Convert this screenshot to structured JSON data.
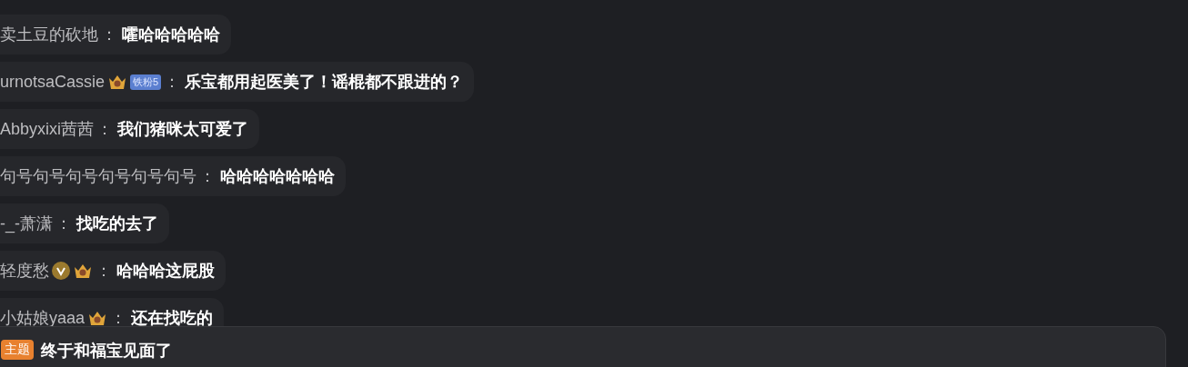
{
  "messages": [
    {
      "name": "卖土豆的砍地",
      "separator": "：",
      "text": "嚯哈哈哈哈哈"
    },
    {
      "name": "urnotsaCassie",
      "badges": [
        {
          "kind": "crown"
        },
        {
          "kind": "fan",
          "label": "铁粉5"
        }
      ],
      "separator": "：",
      "text": "乐宝都用起医美了！谣棍都不跟进的？"
    },
    {
      "name": "Abbyxixi茜茜",
      "separator": "：",
      "text": "我们猪咪太可爱了"
    },
    {
      "name": "句号句号句号句号句号句号",
      "separator": "：",
      "text": "哈哈哈哈哈哈哈"
    },
    {
      "name": "-_-萧潇",
      "separator": "：",
      "text": "找吃的去了"
    },
    {
      "name": "轻度愁",
      "badges": [
        {
          "kind": "verified"
        },
        {
          "kind": "crown"
        }
      ],
      "separator": "：",
      "text": "哈哈哈这屁股"
    },
    {
      "name": "小姑娘yaaa",
      "badges": [
        {
          "kind": "crown"
        }
      ],
      "separator": "：",
      "text": "还在找吃的"
    }
  ],
  "topic": {
    "tag": "主题",
    "text": "终于和福宝见面了"
  }
}
